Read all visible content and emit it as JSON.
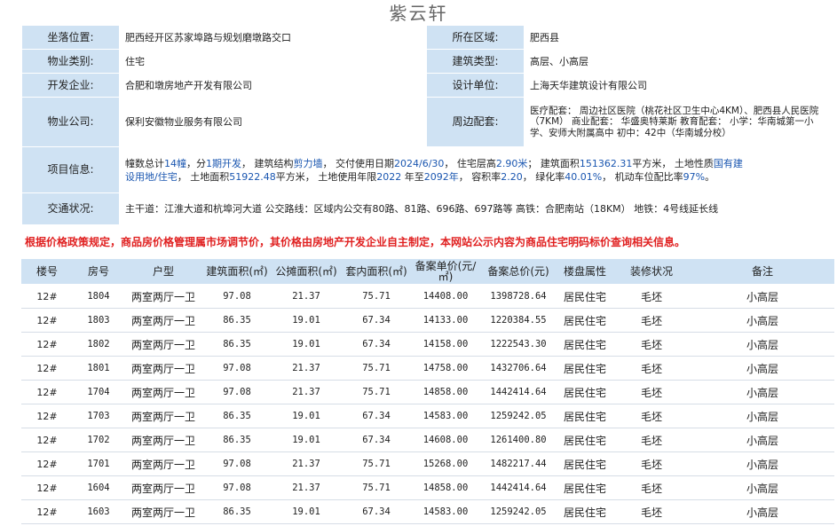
{
  "page": {
    "title": "紫云轩"
  },
  "info": {
    "location_label": "坐落位置:",
    "location_value": "肥西经开区苏家埠路与规划磨墩路交口",
    "district_label": "所在区域:",
    "district_value": "肥西县",
    "property_type_label": "物业类别:",
    "property_type_value": "住宅",
    "building_type_label": "建筑类型:",
    "building_type_value": "高层、小高层",
    "developer_label": "开发企业:",
    "developer_value": "合肥和墩房地产开发有限公司",
    "designer_label": "设计单位:",
    "designer_value": "上海天华建筑设计有限公司",
    "management_label": "物业公司:",
    "management_value": "保利安徽物业服务有限公司",
    "surroundings_label": "周边配套:",
    "surroundings_value": "医疗配套： 周边社区医院（桃花社区卫生中心4KM）、肥西县人民医院（7KM） 商业配套： 华盛奥特莱斯 教育配套： 小学：华南城第一小学、安师大附属高中 初中：42中（华南城分校）",
    "project_label": "项目信息:",
    "project": {
      "p1": "幢数总计",
      "buildings": "14幢",
      "p2": "，分",
      "phases": "1期开发",
      "p3": "， 建筑结构",
      "structure": "剪力墙",
      "p4": "， 交付使用日期",
      "delivery": "2024/6/30",
      "p5": "， 住宅层高",
      "floor_height": "2.90米",
      "p6": "； 建筑面积",
      "gfa": "151362.31",
      "p7": "平方米， 土地性质",
      "land_nature": "国有建设用地/住宅",
      "p8": "， 土地面积",
      "land_area": "51922.48",
      "p9": "平方米， 土地使用年限",
      "land_from": "2022",
      "p10": " 年至",
      "land_to": "2092年",
      "p11": "， 容积率",
      "far": "2.20",
      "p12": "， 绿化率",
      "green": "40.01%",
      "p13": "， 机动车位配比率",
      "parking": "97%",
      "p14": "。"
    },
    "traffic_label": "交通状况:",
    "traffic_value": "主干道：江淮大道和杭埠河大道 公交路线：区域内公交有80路、81路、696路、697路等 高铁：合肥南站（18KM） 地铁：4号线延长线"
  },
  "notice": "根据价格政策规定，商品房价格管理属市场调节价，其价格由房地产开发企业自主制定，本网站公示内容为商品住宅明码标价查询相关信息。",
  "units": {
    "headers": {
      "building": "楼号",
      "room": "房号",
      "layout": "户型",
      "gross_area": "建筑面积(㎡)",
      "shared_area": "公摊面积(㎡)",
      "inner_area": "套内面积(㎡)",
      "unit_price_l1": "备案单价(元/",
      "unit_price_l2": "㎡)",
      "total_price": "备案总价(元)",
      "attribute": "楼盘属性",
      "decoration": "装修状况",
      "remark": "备注"
    },
    "rows": [
      {
        "building": "12#",
        "room": "1804",
        "layout": "两室两厅一卫",
        "gross_area": "97.08",
        "shared_area": "21.37",
        "inner_area": "75.71",
        "unit_price": "14408.00",
        "total_price": "1398728.64",
        "attribute": "居民住宅",
        "decoration": "毛坯",
        "remark": "小高层"
      },
      {
        "building": "12#",
        "room": "1803",
        "layout": "两室两厅一卫",
        "gross_area": "86.35",
        "shared_area": "19.01",
        "inner_area": "67.34",
        "unit_price": "14133.00",
        "total_price": "1220384.55",
        "attribute": "居民住宅",
        "decoration": "毛坯",
        "remark": "小高层"
      },
      {
        "building": "12#",
        "room": "1802",
        "layout": "两室两厅一卫",
        "gross_area": "86.35",
        "shared_area": "19.01",
        "inner_area": "67.34",
        "unit_price": "14158.00",
        "total_price": "1222543.30",
        "attribute": "居民住宅",
        "decoration": "毛坯",
        "remark": "小高层"
      },
      {
        "building": "12#",
        "room": "1801",
        "layout": "两室两厅一卫",
        "gross_area": "97.08",
        "shared_area": "21.37",
        "inner_area": "75.71",
        "unit_price": "14758.00",
        "total_price": "1432706.64",
        "attribute": "居民住宅",
        "decoration": "毛坯",
        "remark": "小高层"
      },
      {
        "building": "12#",
        "room": "1704",
        "layout": "两室两厅一卫",
        "gross_area": "97.08",
        "shared_area": "21.37",
        "inner_area": "75.71",
        "unit_price": "14858.00",
        "total_price": "1442414.64",
        "attribute": "居民住宅",
        "decoration": "毛坯",
        "remark": "小高层"
      },
      {
        "building": "12#",
        "room": "1703",
        "layout": "两室两厅一卫",
        "gross_area": "86.35",
        "shared_area": "19.01",
        "inner_area": "67.34",
        "unit_price": "14583.00",
        "total_price": "1259242.05",
        "attribute": "居民住宅",
        "decoration": "毛坯",
        "remark": "小高层"
      },
      {
        "building": "12#",
        "room": "1702",
        "layout": "两室两厅一卫",
        "gross_area": "86.35",
        "shared_area": "19.01",
        "inner_area": "67.34",
        "unit_price": "14608.00",
        "total_price": "1261400.80",
        "attribute": "居民住宅",
        "decoration": "毛坯",
        "remark": "小高层"
      },
      {
        "building": "12#",
        "room": "1701",
        "layout": "两室两厅一卫",
        "gross_area": "97.08",
        "shared_area": "21.37",
        "inner_area": "75.71",
        "unit_price": "15268.00",
        "total_price": "1482217.44",
        "attribute": "居民住宅",
        "decoration": "毛坯",
        "remark": "小高层"
      },
      {
        "building": "12#",
        "room": "1604",
        "layout": "两室两厅一卫",
        "gross_area": "97.08",
        "shared_area": "21.37",
        "inner_area": "75.71",
        "unit_price": "14858.00",
        "total_price": "1442414.64",
        "attribute": "居民住宅",
        "decoration": "毛坯",
        "remark": "小高层"
      },
      {
        "building": "12#",
        "room": "1603",
        "layout": "两室两厅一卫",
        "gross_area": "86.35",
        "shared_area": "19.01",
        "inner_area": "67.34",
        "unit_price": "14583.00",
        "total_price": "1259242.05",
        "attribute": "居民住宅",
        "decoration": "毛坯",
        "remark": "小高层"
      }
    ]
  }
}
